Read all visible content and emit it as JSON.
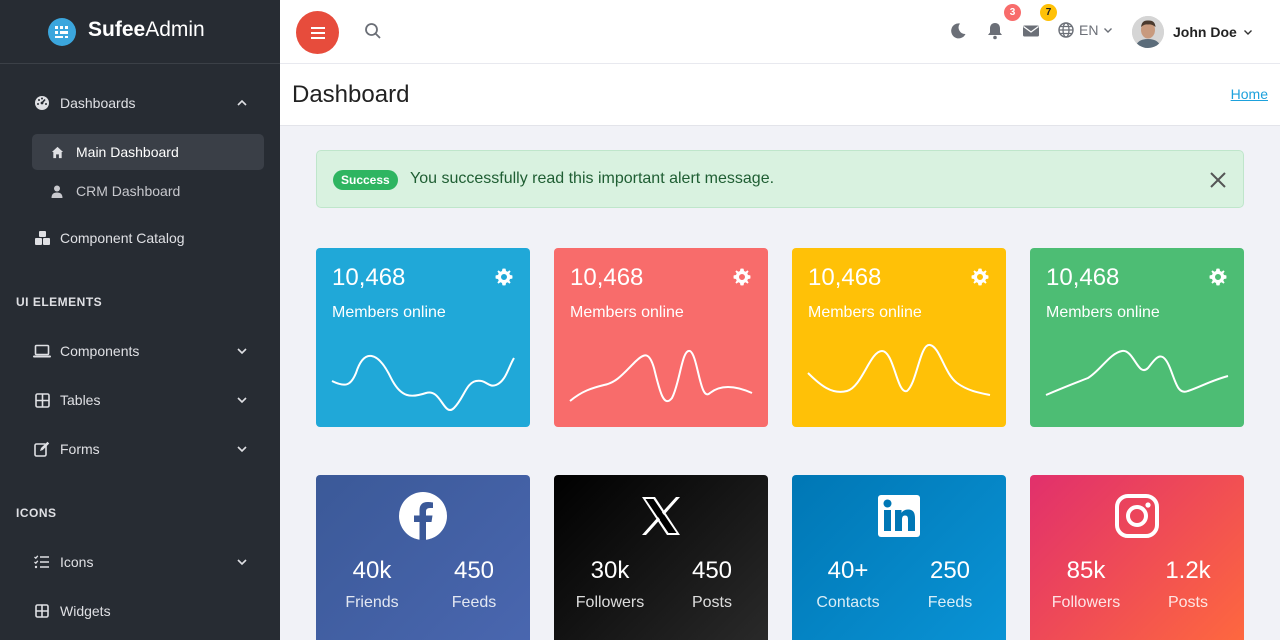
{
  "brand": {
    "name_bold": "Sufee",
    "name_regular": "Admin"
  },
  "sidebar": {
    "dashboards": "Dashboards",
    "main_dashboard": "Main Dashboard",
    "crm_dashboard": "CRM Dashboard",
    "component_catalog": "Component Catalog",
    "section_ui": "UI ELEMENTS",
    "components": "Components",
    "tables": "Tables",
    "forms": "Forms",
    "section_icons": "ICONS",
    "icons": "Icons",
    "widgets": "Widgets"
  },
  "header": {
    "notifications_count": "3",
    "messages_count": "7",
    "language": "EN",
    "user_name": "John Doe"
  },
  "page": {
    "title": "Dashboard",
    "breadcrumb": "Home"
  },
  "alert": {
    "badge": "Success",
    "message": "You successfully read this important alert message."
  },
  "stats": [
    {
      "value": "10,468",
      "label": "Members online",
      "color": "#20a8d8"
    },
    {
      "value": "10,468",
      "label": "Members online",
      "color": "#f86c6b"
    },
    {
      "value": "10,468",
      "label": "Members online",
      "color": "#ffc107"
    },
    {
      "value": "10,468",
      "label": "Members online",
      "color": "#4dbd74"
    }
  ],
  "social": [
    {
      "network": "facebook",
      "icon": "facebook-icon",
      "left_num": "40k",
      "left_label": "Friends",
      "right_num": "450",
      "right_label": "Feeds"
    },
    {
      "network": "x",
      "icon": "x-icon",
      "left_num": "30k",
      "left_label": "Followers",
      "right_num": "450",
      "right_label": "Posts"
    },
    {
      "network": "linkedin",
      "icon": "linkedin-icon",
      "left_num": "40+",
      "left_label": "Contacts",
      "right_num": "250",
      "right_label": "Feeds"
    },
    {
      "network": "instagram",
      "icon": "instagram-icon",
      "left_num": "85k",
      "left_label": "Followers",
      "right_num": "1.2k",
      "right_label": "Posts"
    }
  ],
  "colors": {
    "sidebar_bg": "#272c33",
    "accent_red": "#e74c3c",
    "link": "#1da1dc"
  }
}
